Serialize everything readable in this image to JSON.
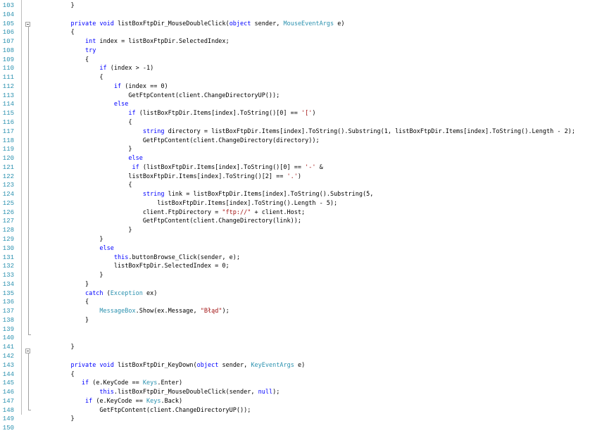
{
  "editor": {
    "first_line_number": 103,
    "lines": [
      [
        {
          "t": "    }"
        }
      ],
      [
        {
          "t": ""
        }
      ],
      [
        {
          "t": "    "
        },
        {
          "t": "private",
          "c": "kw"
        },
        {
          "t": " "
        },
        {
          "t": "void",
          "c": "kw"
        },
        {
          "t": " listBoxFtpDir_MouseDoubleClick("
        },
        {
          "t": "object",
          "c": "kw"
        },
        {
          "t": " sender, "
        },
        {
          "t": "MouseEventArgs",
          "c": "ty"
        },
        {
          "t": " e)"
        }
      ],
      [
        {
          "t": "    {"
        }
      ],
      [
        {
          "t": "        "
        },
        {
          "t": "int",
          "c": "kw"
        },
        {
          "t": " index = listBoxFtpDir.SelectedIndex;"
        }
      ],
      [
        {
          "t": "        "
        },
        {
          "t": "try",
          "c": "kw"
        }
      ],
      [
        {
          "t": "        {"
        }
      ],
      [
        {
          "t": "            "
        },
        {
          "t": "if",
          "c": "kw"
        },
        {
          "t": " (index > -1)"
        }
      ],
      [
        {
          "t": "            {"
        }
      ],
      [
        {
          "t": "                "
        },
        {
          "t": "if",
          "c": "kw"
        },
        {
          "t": " (index == 0)"
        }
      ],
      [
        {
          "t": "                    GetFtpContent(client.ChangeDirectoryUP());"
        }
      ],
      [
        {
          "t": "                "
        },
        {
          "t": "else",
          "c": "kw"
        }
      ],
      [
        {
          "t": "                    "
        },
        {
          "t": "if",
          "c": "kw"
        },
        {
          "t": " (listBoxFtpDir.Items[index].ToString()[0] == "
        },
        {
          "t": "'['",
          "c": "st"
        },
        {
          "t": ")"
        }
      ],
      [
        {
          "t": "                    {"
        }
      ],
      [
        {
          "t": "                        "
        },
        {
          "t": "string",
          "c": "kw"
        },
        {
          "t": " directory = listBoxFtpDir.Items[index].ToString().Substring(1, listBoxFtpDir.Items[index].ToString().Length - 2);"
        }
      ],
      [
        {
          "t": "                        GetFtpContent(client.ChangeDirectory(directory));"
        }
      ],
      [
        {
          "t": "                    }"
        }
      ],
      [
        {
          "t": "                    "
        },
        {
          "t": "else",
          "c": "kw"
        }
      ],
      [
        {
          "t": "                     "
        },
        {
          "t": "if",
          "c": "kw"
        },
        {
          "t": " (listBoxFtpDir.Items[index].ToString()[0] == "
        },
        {
          "t": "'-'",
          "c": "st"
        },
        {
          "t": " &"
        }
      ],
      [
        {
          "t": "                    listBoxFtpDir.Items[index].ToString()[2] == "
        },
        {
          "t": "'.'",
          "c": "st"
        },
        {
          "t": ")"
        }
      ],
      [
        {
          "t": "                    {"
        }
      ],
      [
        {
          "t": "                        "
        },
        {
          "t": "string",
          "c": "kw"
        },
        {
          "t": " link = listBoxFtpDir.Items[index].ToString().Substring(5,"
        }
      ],
      [
        {
          "t": "                            listBoxFtpDir.Items[index].ToString().Length - 5);"
        }
      ],
      [
        {
          "t": "                        client.FtpDirectory = "
        },
        {
          "t": "\"ftp://\"",
          "c": "st"
        },
        {
          "t": " + client.Host;"
        }
      ],
      [
        {
          "t": "                        GetFtpContent(client.ChangeDirectory(link));"
        }
      ],
      [
        {
          "t": "                    }"
        }
      ],
      [
        {
          "t": "            }"
        }
      ],
      [
        {
          "t": "            "
        },
        {
          "t": "else",
          "c": "kw"
        }
      ],
      [
        {
          "t": "                "
        },
        {
          "t": "this",
          "c": "kw"
        },
        {
          "t": ".buttonBrowse_Click(sender, e);"
        }
      ],
      [
        {
          "t": "                listBoxFtpDir.SelectedIndex = 0;"
        }
      ],
      [
        {
          "t": "            }"
        }
      ],
      [
        {
          "t": "        }"
        }
      ],
      [
        {
          "t": "        "
        },
        {
          "t": "catch",
          "c": "kw"
        },
        {
          "t": " ("
        },
        {
          "t": "Exception",
          "c": "ty"
        },
        {
          "t": " ex)"
        }
      ],
      [
        {
          "t": "        {"
        }
      ],
      [
        {
          "t": "            "
        },
        {
          "t": "MessageBox",
          "c": "ty"
        },
        {
          "t": ".Show(ex.Message, "
        },
        {
          "t": "\"Błąd\"",
          "c": "st"
        },
        {
          "t": ");"
        }
      ],
      [
        {
          "t": "        }"
        }
      ],
      [
        {
          "t": ""
        }
      ],
      [
        {
          "t": ""
        }
      ],
      [
        {
          "t": "    }"
        }
      ],
      [
        {
          "t": ""
        }
      ],
      [
        {
          "t": "    "
        },
        {
          "t": "private",
          "c": "kw"
        },
        {
          "t": " "
        },
        {
          "t": "void",
          "c": "kw"
        },
        {
          "t": " listBoxFtpDir_KeyDown("
        },
        {
          "t": "object",
          "c": "kw"
        },
        {
          "t": " sender, "
        },
        {
          "t": "KeyEventArgs",
          "c": "ty"
        },
        {
          "t": " e)"
        }
      ],
      [
        {
          "t": "    {"
        }
      ],
      [
        {
          "t": "       "
        },
        {
          "t": "if",
          "c": "kw"
        },
        {
          "t": " (e.KeyCode == "
        },
        {
          "t": "Keys",
          "c": "ty"
        },
        {
          "t": ".Enter)"
        }
      ],
      [
        {
          "t": "            "
        },
        {
          "t": "this",
          "c": "kw"
        },
        {
          "t": ".listBoxFtpDir_MouseDoubleClick(sender, "
        },
        {
          "t": "null",
          "c": "kw"
        },
        {
          "t": ");"
        }
      ],
      [
        {
          "t": "        "
        },
        {
          "t": "if",
          "c": "kw"
        },
        {
          "t": " (e.KeyCode == "
        },
        {
          "t": "Keys",
          "c": "ty"
        },
        {
          "t": ".Back)"
        }
      ],
      [
        {
          "t": "            GetFtpContent(client.ChangeDirectoryUP());"
        }
      ],
      [
        {
          "t": "    }"
        }
      ],
      [
        {
          "t": ""
        }
      ]
    ]
  }
}
